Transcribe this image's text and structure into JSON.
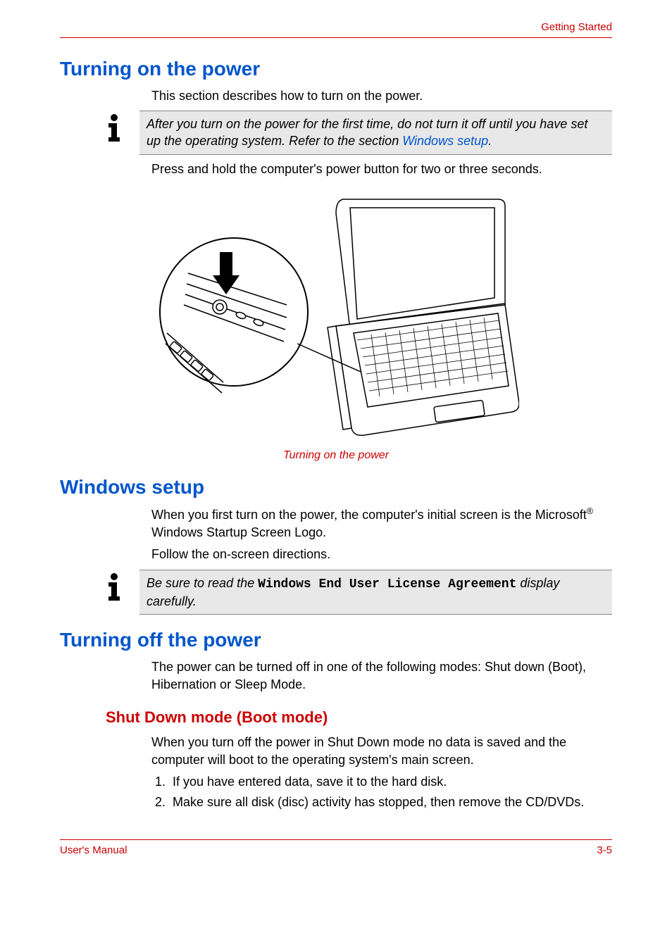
{
  "header": {
    "breadcrumb": "Getting Started"
  },
  "section1": {
    "heading": "Turning on the power",
    "p1": "This section describes how to turn on the power.",
    "note_pre": "After you turn on the power for the first time, do not turn it off until you have set up the operating system. Refer to the section ",
    "note_link": "Windows setup",
    "note_post": ".",
    "p2": "Press and hold the computer's power button for two or three seconds.",
    "caption": "Turning on the power"
  },
  "section2": {
    "heading": "Windows setup",
    "p1_pre": "When you first turn on the power, the computer's initial screen is the Microsoft",
    "p1_sup": "®",
    "p1_post": " Windows Startup Screen Logo.",
    "p2": "Follow the on-screen directions.",
    "note_pre": "Be sure to read the ",
    "note_mono": "Windows End User License Agreement",
    "note_post": " display carefully."
  },
  "section3": {
    "heading": "Turning off the power",
    "p1": "The power can be turned off in one of the following modes: Shut down (Boot), Hibernation or Sleep Mode.",
    "sub_heading": "Shut Down mode (Boot mode)",
    "p2": "When you turn off the power in Shut Down mode no data is saved and the computer will boot to the operating system's main screen.",
    "li1": "If you have entered data, save it to the hard disk.",
    "li2": "Make sure all disk (disc) activity has stopped, then remove the CD/DVDs."
  },
  "footer": {
    "left": "User's Manual",
    "right": "3-5"
  }
}
